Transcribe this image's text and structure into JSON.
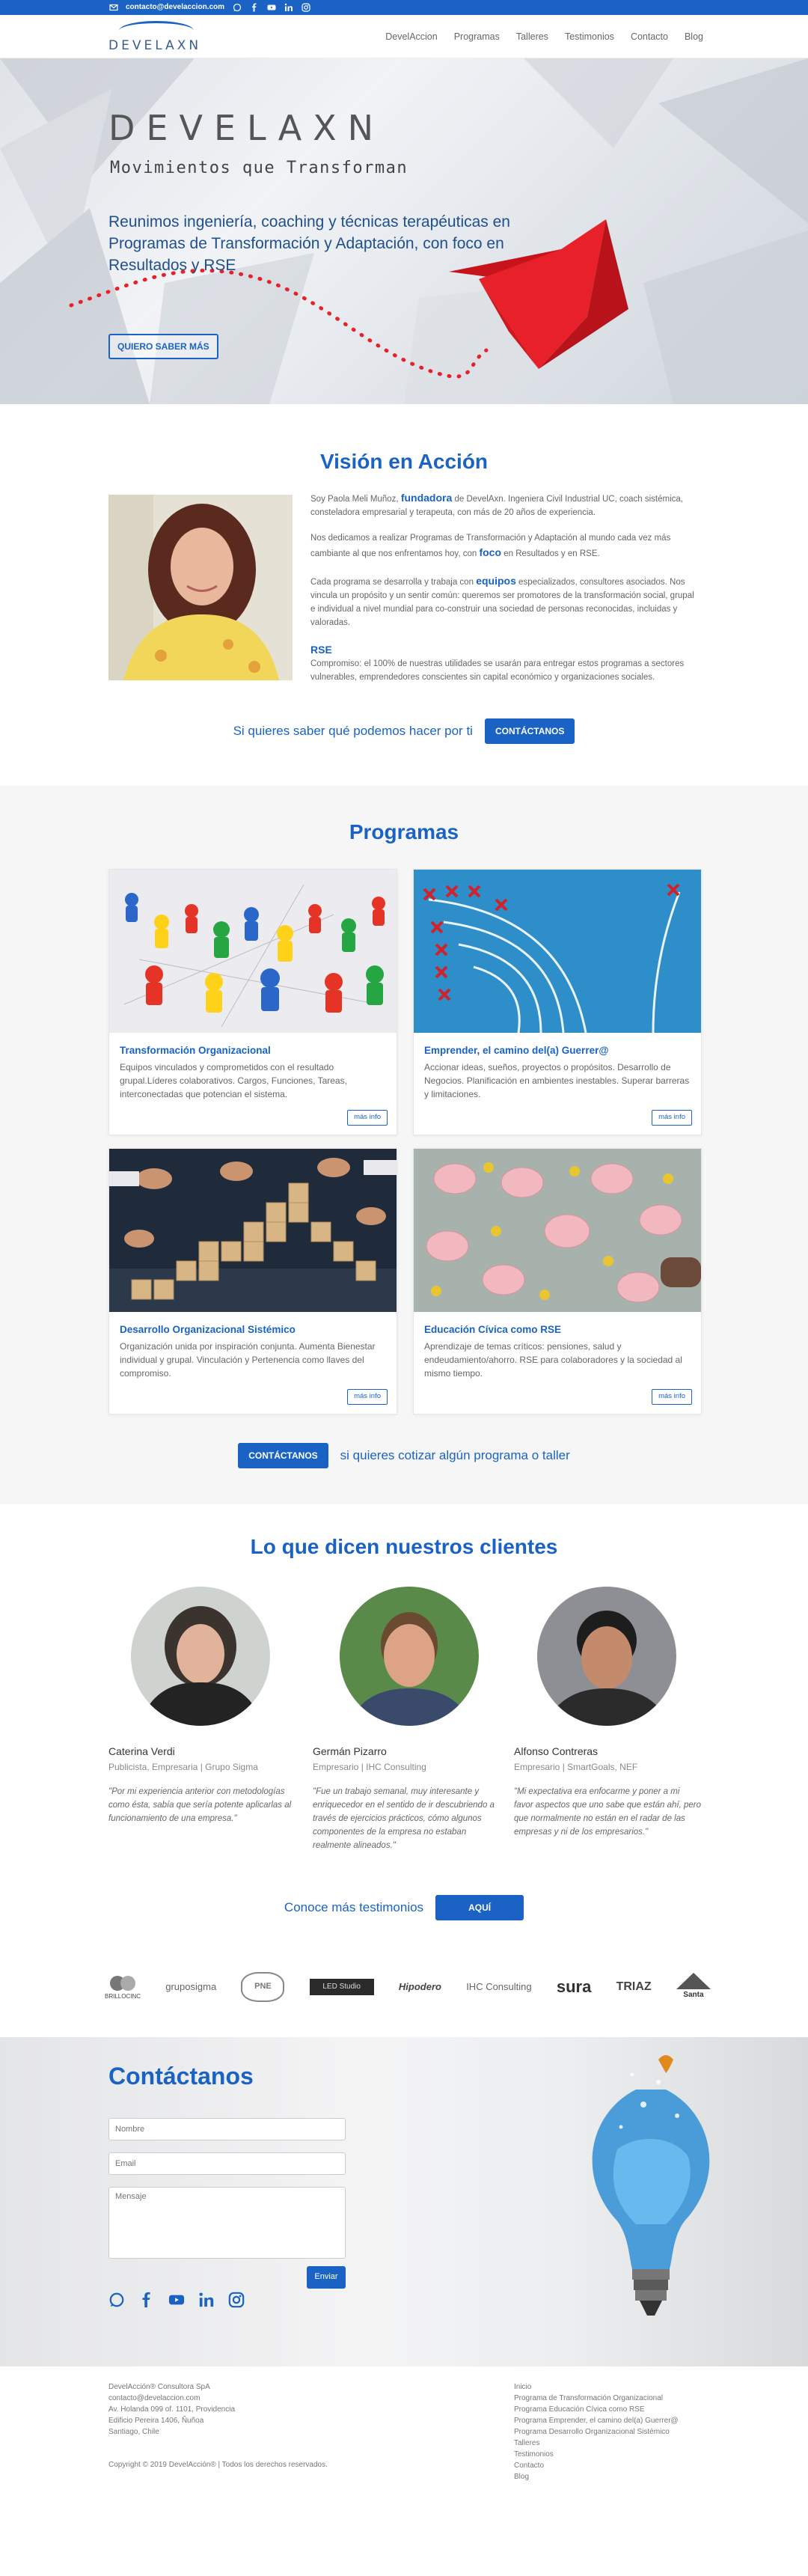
{
  "topbar": {
    "email": "contacto@develaccion.com"
  },
  "header": {
    "logo_text": "DEVELAXN",
    "nav": [
      "DevelAccion",
      "Programas",
      "Talleres",
      "Testimonios",
      "Contacto",
      "Blog"
    ]
  },
  "hero": {
    "title": "DEVELAXN",
    "subtitle": "Movimientos que Transforman",
    "lead": "Reunimos ingeniería, coaching y técnicas terapéuticas en Programas de Transformación y Adaptación, con foco en Resultados y RSE",
    "cta": "QUIERO SABER MÁS"
  },
  "vision": {
    "title": "Visión en Acción",
    "p1_a": "Soy Paola Meli Muñoz, ",
    "p1_hl": "fundadora",
    "p1_b": " de DevelAxn. Ingeniera Civil Industrial UC, coach sistémica, consteladora empresarial y terapeuta, con más de 20 años de experiencia.",
    "p2_a": "Nos dedicamos a realizar Programas de Transformación y Adaptación al mundo cada vez más cambiante al que nos enfrentamos hoy, con ",
    "p2_hl": "foco",
    "p2_b": " en Resultados y en RSE.",
    "p3_a": "Cada programa se desarrolla y trabaja con ",
    "p3_hl": "equipos",
    "p3_b": " especializados, consultores asociados. Nos vincula un propósito y un sentir común: queremos ser promotores de la transformación social, grupal e individual a nivel mundial para co-construir una sociedad de personas reconocidas, incluidas y valoradas.",
    "p4_hl": "RSE",
    "p4_b": "Compromiso: el 100% de nuestras utilidades se usarán para entregar estos programas a sectores vulnerables, emprendedores conscientes sin capital económico y organizaciones sociales.",
    "cta_text": "Si quieres saber qué podemos hacer por ti",
    "cta_button": "CONTÁCTANOS"
  },
  "programas": {
    "title": "Programas",
    "cards": [
      {
        "title": "Transformación Organizacional",
        "desc": "Equipos vinculados y comprometidos con el resultado grupal.Líderes colaborativos. Cargos, Funciones, Tareas, interconectadas que potencian el sistema.",
        "more": "más info"
      },
      {
        "title": "Emprender, el camino del(a) Guerrer@",
        "desc": "Accionar ideas, sueños, proyectos o propósitos. Desarrollo de Negocios. Planificación en ambientes inestables. Superar barreras y limitaciones.",
        "more": "más info"
      },
      {
        "title": "Desarrollo Organizacional Sistémico",
        "desc": "Organización unida por inspiración conjunta. Aumenta Bienestar individual y grupal. Vinculación y Pertenencia como llaves del compromiso.",
        "more": "más info"
      },
      {
        "title": "Educación Cívica como RSE",
        "desc": "Aprendizaje de temas críticos: pensiones, salud y endeudamiento/ahorro. RSE para colaboradores y la sociedad al mismo tiempo.",
        "more": "más info"
      }
    ],
    "cta_button": "CONTÁCTANOS",
    "cta_text": "si quieres cotizar algún programa o taller"
  },
  "testimonios": {
    "title": "Lo que dicen nuestros clientes",
    "people": [
      {
        "name": "Caterina Verdi",
        "role": "Publicista, Empresaria | Grupo Sigma",
        "quote": "\"Por mi experiencia anterior con metodologías como ésta, sabía que sería potente aplicarlas al funcionamiento de una empresa.\""
      },
      {
        "name": "Germán Pizarro",
        "role": "Empresario | IHC Consulting",
        "quote": "\"Fue un trabajo semanal, muy interesante y enriquecedor en el sentido de ir descubriendo a través de ejercicios prácticos, cómo algunos componentes de la empresa no estaban realmente alineados.\""
      },
      {
        "name": "Alfonso Contreras",
        "role": "Empresario | SmartGoals, NEF",
        "quote": "\"Mi expectativa era enfocarme y poner a mi favor aspectos que uno sabe que están ahí, pero que normalmente no están en el radar de las empresas y ni de los empresarios.\""
      }
    ],
    "more_text": "Conoce más testimonios",
    "more_button": "AQUÍ"
  },
  "logos": [
    "BRILLOCINC",
    "gruposigma",
    "PNE",
    "LED Studio",
    "Hipodero",
    "IHC Consulting",
    "sura",
    "TRIAZ",
    "Santa"
  ],
  "contact": {
    "title": "Contáctanos",
    "name_ph": "Nombre",
    "email_ph": "Email",
    "msg_ph": "Mensaje",
    "send": "Enviar"
  },
  "footer": {
    "col1": [
      "DevelAcción® Consultora SpA",
      "contacto@develaccion.com",
      "Av. Holanda 099 of. 1101, Providencia",
      "Edificio Pereira 1406, Ñuñoa",
      "Santiago, Chile"
    ],
    "copyright": "Copyright © 2019 DevelAcción® | Todos los derechos reservados.",
    "col2": [
      "Inicio",
      "Programa de Transformación Organizacional",
      "Programa Educación Cívica como RSE",
      "Programa Emprender, el camino del(a) Guerrer@",
      "Programa Desarrollo Organizacional Sistémico",
      "Talleres",
      "Testimonios",
      "Contacto",
      "Blog"
    ]
  },
  "colors": {
    "accent": "#1a63c4",
    "hero_boat": "#e8202a",
    "footer_bg": "#ffffff"
  }
}
